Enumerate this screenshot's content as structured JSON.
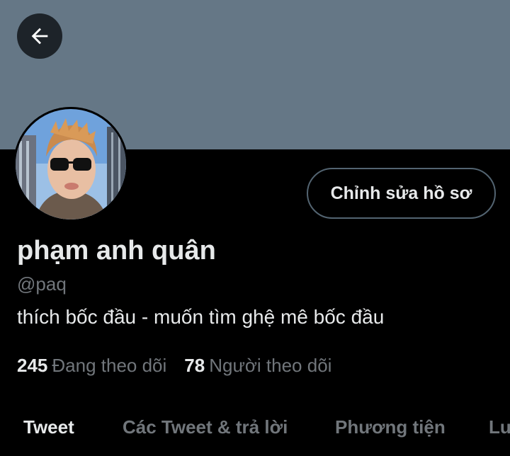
{
  "colors": {
    "banner": "#657786",
    "background": "#000000",
    "primary_text": "#e7e9ea",
    "secondary_text": "#71767b",
    "button_border": "#536471"
  },
  "header": {
    "back_icon": "arrow-left-icon"
  },
  "profile": {
    "name": "phạm anh quân",
    "handle": "@paq",
    "bio": "thích bốc đầu - muốn tìm ghệ mê bốc đầu",
    "edit_button_label": "Chỉnh sửa hồ sơ",
    "following_count": "245",
    "following_label": "Đang theo dõi",
    "followers_count": "78",
    "followers_label": "Người theo dõi"
  },
  "tabs": [
    {
      "label": "Tweet",
      "active": true
    },
    {
      "label": "Các Tweet & trả lời",
      "active": false
    },
    {
      "label": "Phương tiện",
      "active": false
    },
    {
      "label": "Lu",
      "active": false
    }
  ]
}
